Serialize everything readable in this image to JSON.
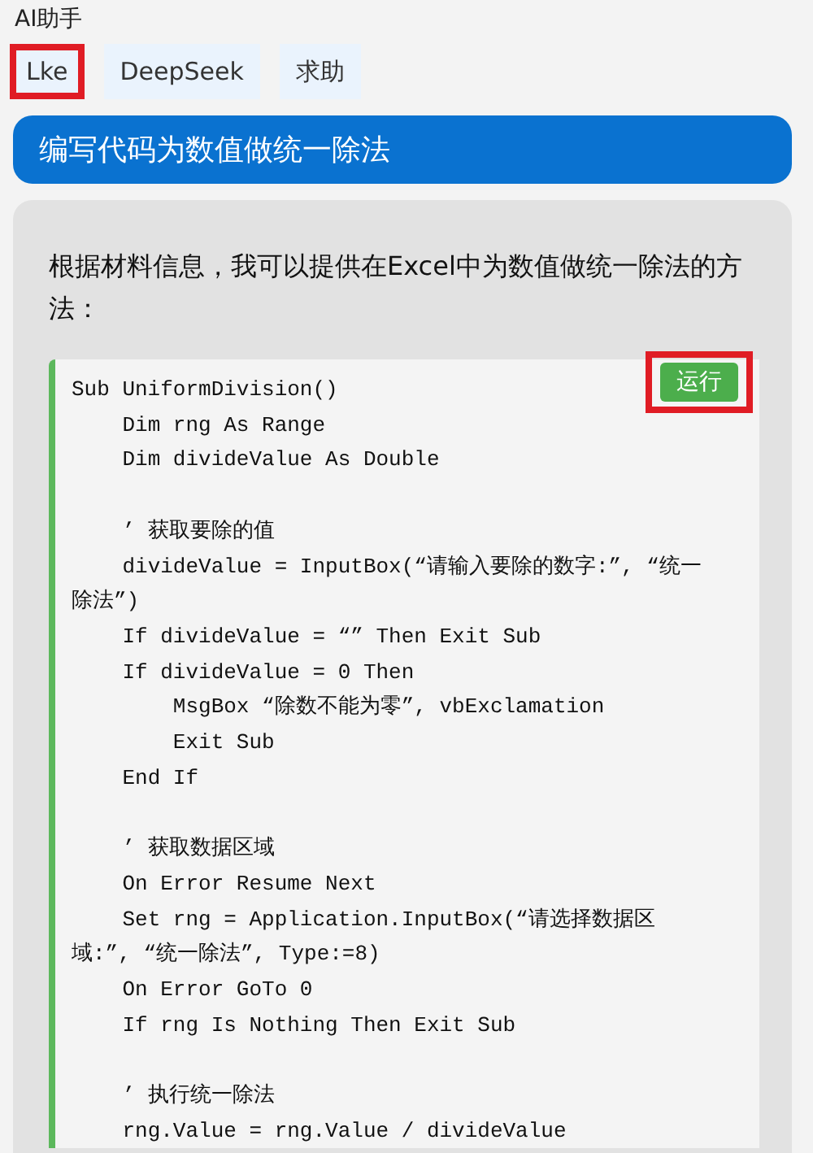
{
  "window": {
    "title": "AI助手"
  },
  "tabs": [
    {
      "label": "Lke",
      "selected": false,
      "highlighted": true
    },
    {
      "label": "DeepSeek",
      "selected": false,
      "highlighted": false
    },
    {
      "label": "求助",
      "selected": false,
      "highlighted": false
    }
  ],
  "prompt": "编写代码为数值做统一除法",
  "answer": {
    "intro": "根据材料信息，我可以提供在Excel中为数值做统一除法的方法：",
    "run_button": {
      "label": "运行",
      "highlighted": true
    },
    "code_blocks": [
      [
        "Sub UniformDivision()",
        "    Dim rng As Range",
        "    Dim divideValue As Double"
      ],
      [
        "    ’ 获取要除的值",
        "    divideValue = InputBox(“请输入要除的数字:”, “统一除法”)",
        "    If divideValue = “” Then Exit Sub",
        "    If divideValue = 0 Then",
        "        MsgBox “除数不能为零”, vbExclamation",
        "        Exit Sub",
        "    End If"
      ],
      [
        "    ’ 获取数据区域",
        "    On Error Resume Next",
        "    Set rng = Application.InputBox(“请选择数据区域:”, “统一除法”, Type:=8)",
        "    On Error GoTo 0",
        "    If rng Is Nothing Then Exit Sub"
      ],
      [
        "    ’ 执行统一除法",
        "    rng.Value = rng.Value / divideValue"
      ]
    ]
  }
}
